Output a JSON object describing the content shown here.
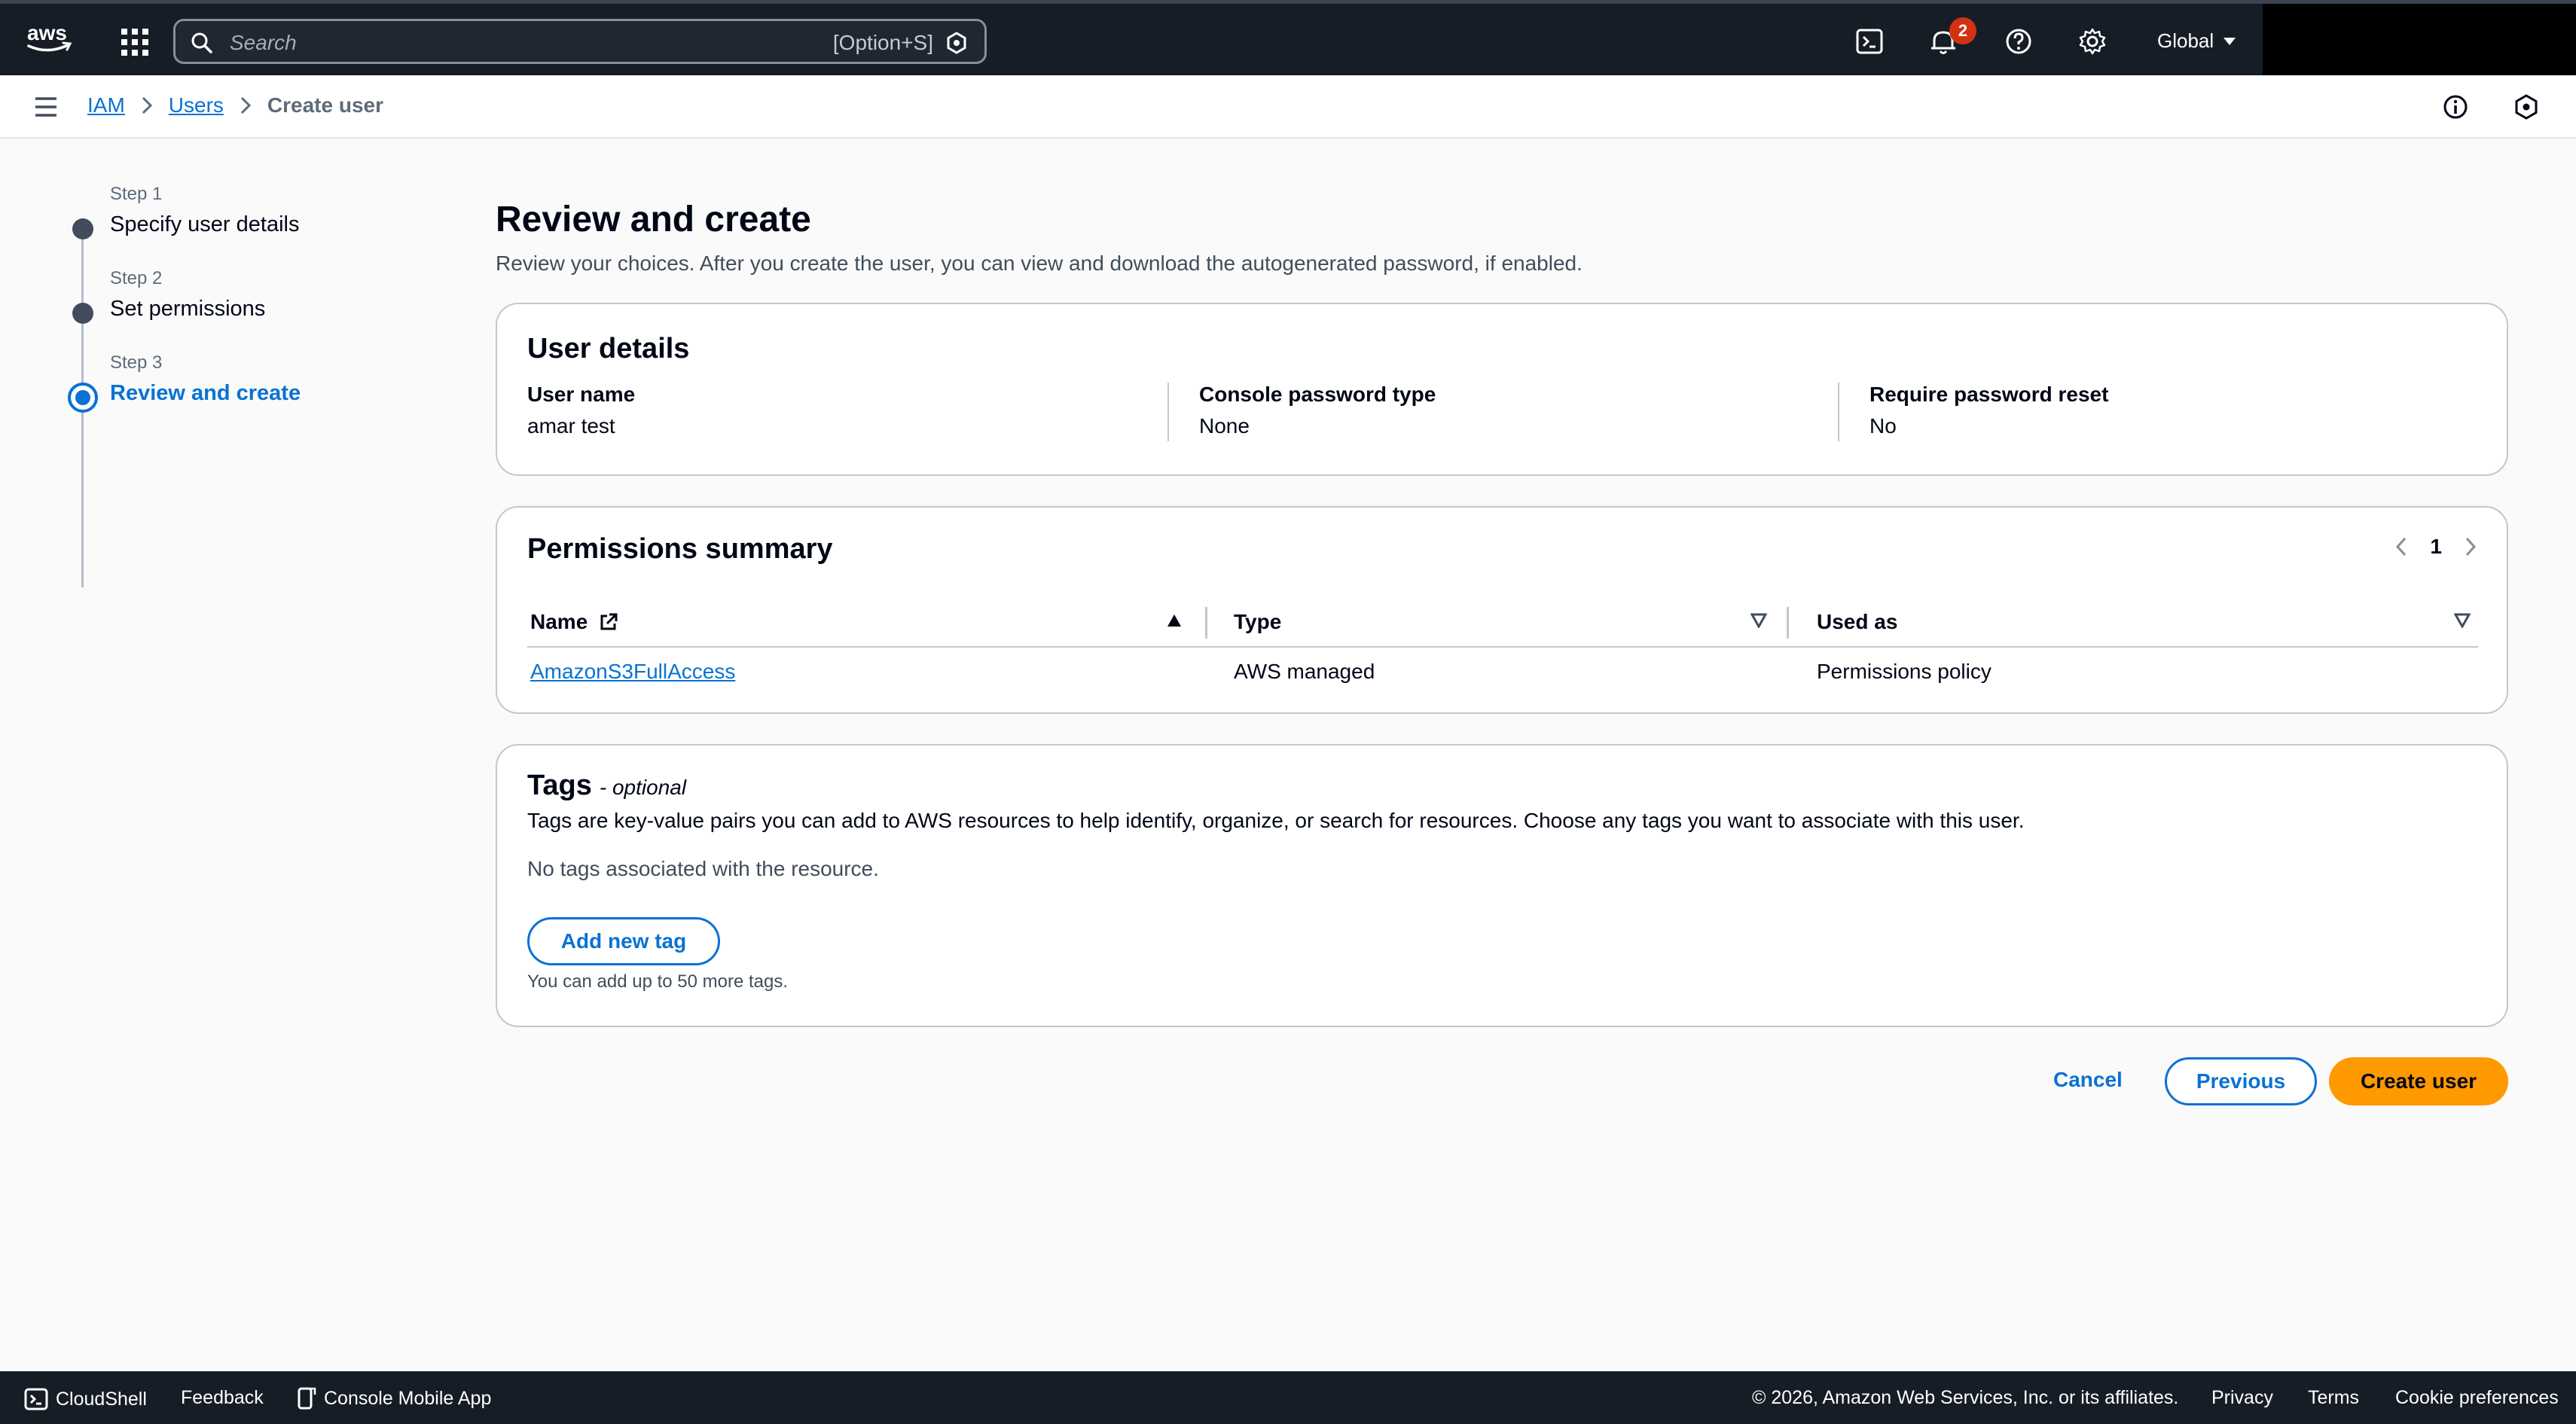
{
  "topnav": {
    "search_placeholder": "Search",
    "search_shortcut": "[Option+S]",
    "notification_count": "2",
    "region": "Global",
    "icons": [
      "aws-logo",
      "apps-grid-icon",
      "search-icon",
      "cloudshell-icon",
      "bell-icon",
      "help-icon",
      "settings-icon",
      "caret-down-icon"
    ]
  },
  "breadcrumb": {
    "items": [
      "IAM",
      "Users"
    ],
    "current": "Create user"
  },
  "steps": [
    {
      "label": "Step 1",
      "title": "Specify user details"
    },
    {
      "label": "Step 2",
      "title": "Set permissions"
    },
    {
      "label": "Step 3",
      "title": "Review and create"
    }
  ],
  "main": {
    "title": "Review and create",
    "description": "Review your choices. After you create the user, you can view and download the autogenerated password, if enabled."
  },
  "user_details": {
    "heading": "User details",
    "fields": [
      {
        "key": "User name",
        "value": "amar test"
      },
      {
        "key": "Console password type",
        "value": "None"
      },
      {
        "key": "Require password reset",
        "value": "No"
      }
    ]
  },
  "permissions": {
    "heading": "Permissions summary",
    "page": "1",
    "columns": [
      "Name",
      "Type",
      "Used as"
    ],
    "rows": [
      {
        "name": "AmazonS3FullAccess",
        "type": "AWS managed",
        "used_as": "Permissions policy"
      }
    ]
  },
  "tags": {
    "heading": "Tags",
    "optional": "- optional",
    "description": "Tags are key-value pairs you can add to AWS resources to help identify, organize, or search for resources. Choose any tags you want to associate with this user.",
    "empty": "No tags associated with the resource.",
    "add_button": "Add new tag",
    "hint": "You can add up to 50 more tags."
  },
  "actions": {
    "cancel": "Cancel",
    "previous": "Previous",
    "create": "Create user"
  },
  "footer": {
    "cloudshell": "CloudShell",
    "feedback": "Feedback",
    "mobile_app": "Console Mobile App",
    "copyright": "© 2026, Amazon Web Services, Inc. or its affiliates.",
    "privacy": "Privacy",
    "terms": "Terms",
    "cookies": "Cookie preferences"
  },
  "colors": {
    "nav_bg": "#161d26",
    "link": "#0972d3",
    "primary_button": "#ff9900",
    "badge": "#d13212"
  }
}
